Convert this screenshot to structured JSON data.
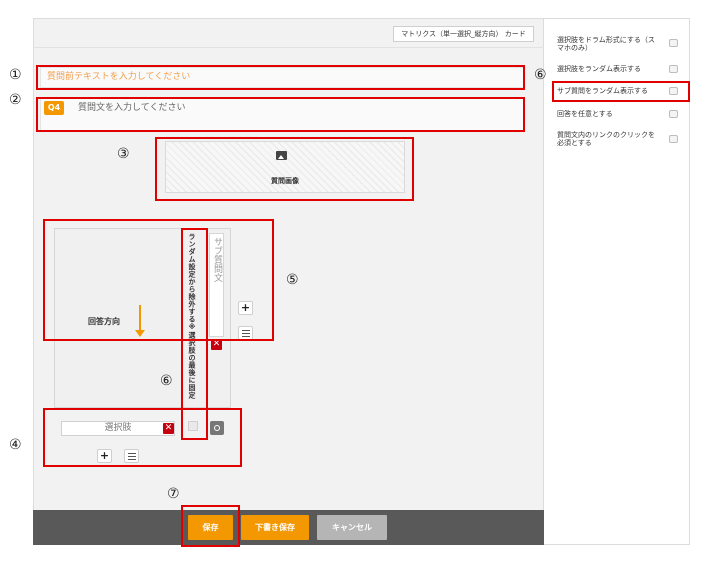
{
  "header": {
    "question_type": "マトリクス（単一選択_縦方向） カード"
  },
  "question": {
    "pre_text_placeholder": "質問前テキストを入力してください",
    "badge": "Q4",
    "text_placeholder": "質問文を入力してください"
  },
  "image": {
    "label": "質問画像",
    "icon": "image-icon"
  },
  "matrix": {
    "answer_direction": "回答方向",
    "random_exclude_label": "ランダム設定から除外する※選択肢の最後に固定",
    "sub_question_placeholder": "サブ質問文",
    "choice_placeholder": "選択肢",
    "add_icon": "+",
    "delete_icon": "✕"
  },
  "footer": {
    "save": "保存",
    "draft_save": "下書き保存",
    "cancel": "キャンセル"
  },
  "options": [
    {
      "label": "選択肢をドラム形式にする（スマホのみ）"
    },
    {
      "label": "選択肢をランダム表示する"
    },
    {
      "label": "サブ質問をランダム表示する"
    },
    {
      "label": "回答を任意とする"
    },
    {
      "label": "質問文内のリンクのクリックを必須とする"
    }
  ],
  "markers": [
    "①",
    "②",
    "③",
    "④",
    "⑤",
    "⑥",
    "⑥",
    "⑦"
  ],
  "colors": {
    "accent": "#f39800",
    "highlight": "#e00000",
    "delete": "#c6000e",
    "footer": "#595959"
  }
}
